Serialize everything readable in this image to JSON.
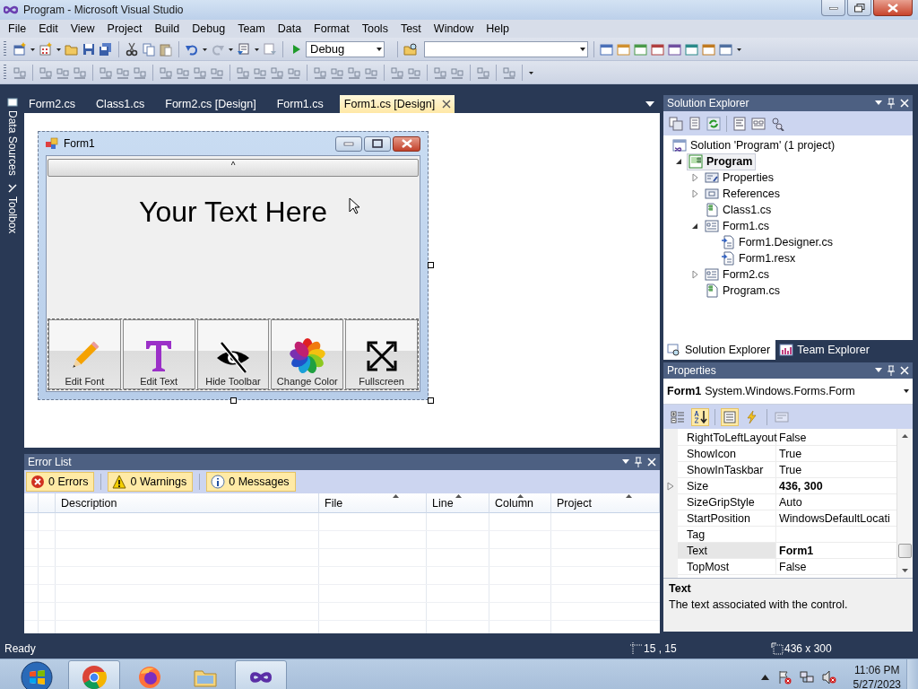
{
  "window": {
    "title": "Program - Microsoft Visual Studio"
  },
  "menu": [
    "File",
    "Edit",
    "View",
    "Project",
    "Build",
    "Debug",
    "Team",
    "Data",
    "Format",
    "Tools",
    "Test",
    "Window",
    "Help"
  ],
  "toolbar": {
    "configuration": "Debug"
  },
  "side_tabs": [
    "Data Sources",
    "Toolbox"
  ],
  "document_tabs": [
    {
      "label": "Form2.cs",
      "selected": false
    },
    {
      "label": "Class1.cs",
      "selected": false
    },
    {
      "label": "Form2.cs [Design]",
      "selected": false
    },
    {
      "label": "Form1.cs",
      "selected": false
    },
    {
      "label": "Form1.cs [Design]",
      "selected": true
    }
  ],
  "designer": {
    "form": {
      "title": "Form1",
      "collapse_glyph": "^",
      "label": "Your Text Here",
      "buttons": [
        {
          "kind": "pencil",
          "label": "Edit Font"
        },
        {
          "kind": "text",
          "label": "Edit Text"
        },
        {
          "kind": "hide",
          "label": "Hide Toolbar"
        },
        {
          "kind": "color",
          "label": "Change Color"
        },
        {
          "kind": "fullscreen",
          "label": "Fullscreen"
        }
      ]
    }
  },
  "error_list": {
    "title": "Error List",
    "filters": [
      {
        "kind": "error",
        "label": "0 Errors",
        "selected": true
      },
      {
        "kind": "warning",
        "label": "0 Warnings",
        "selected": true
      },
      {
        "kind": "message",
        "label": "0 Messages",
        "selected": true
      }
    ],
    "columns": [
      "Description",
      "File",
      "Line",
      "Column",
      "Project"
    ]
  },
  "solution_explorer": {
    "title": "Solution Explorer",
    "tree": [
      {
        "kind": "solution",
        "label": "Solution 'Program' (1 project)",
        "selected": false,
        "children": [
          {
            "kind": "project",
            "label": "Program",
            "expanded": true,
            "selected": true,
            "children": [
              {
                "kind": "properties",
                "label": "Properties",
                "expanded": false,
                "selected": false
              },
              {
                "kind": "references",
                "label": "References",
                "expanded": false,
                "selected": false
              },
              {
                "kind": "csfile",
                "label": "Class1.cs",
                "selected": false
              },
              {
                "kind": "form",
                "label": "Form1.cs",
                "expanded": true,
                "selected": false,
                "children": [
                  {
                    "kind": "designer",
                    "label": "Form1.Designer.cs",
                    "selected": false
                  },
                  {
                    "kind": "designer",
                    "label": "Form1.resx",
                    "selected": false
                  }
                ]
              },
              {
                "kind": "form",
                "label": "Form2.cs",
                "expanded": false,
                "selected": false
              },
              {
                "kind": "csfile",
                "label": "Program.cs",
                "selected": false
              }
            ]
          }
        ]
      }
    ],
    "tabs": [
      {
        "label": "Solution Explorer",
        "selected": true
      },
      {
        "label": "Team Explorer",
        "selected": false
      }
    ]
  },
  "properties": {
    "title": "Properties",
    "object_name": "Form1",
    "object_type": "System.Windows.Forms.Form",
    "tools": [
      {
        "kind": "categorized",
        "selected": false,
        "disabled": false
      },
      {
        "kind": "alphabetical",
        "selected": true,
        "disabled": false
      },
      {
        "kind": "properties",
        "selected": true,
        "disabled": false
      },
      {
        "kind": "events",
        "selected": false,
        "disabled": false
      },
      {
        "kind": "pages",
        "selected": false,
        "disabled": true
      }
    ],
    "rows": [
      {
        "name": "RightToLeftLayout",
        "value": "False",
        "bold": false,
        "expandable": false,
        "selected": false
      },
      {
        "name": "ShowIcon",
        "value": "True",
        "bold": false,
        "expandable": false,
        "selected": false
      },
      {
        "name": "ShowInTaskbar",
        "value": "True",
        "bold": false,
        "expandable": false,
        "selected": false
      },
      {
        "name": "Size",
        "value": "436, 300",
        "bold": true,
        "expandable": true,
        "selected": false
      },
      {
        "name": "SizeGripStyle",
        "value": "Auto",
        "bold": false,
        "expandable": false,
        "selected": false
      },
      {
        "name": "StartPosition",
        "value": "WindowsDefaultLocati",
        "bold": false,
        "expandable": false,
        "selected": false
      },
      {
        "name": "Tag",
        "expandable": false,
        "selected": false
      },
      {
        "name": "Text",
        "value": "Form1",
        "bold": true,
        "expandable": false,
        "selected": true
      },
      {
        "name": "TopMost",
        "value": "False",
        "bold": false,
        "expandable": false,
        "selected": false
      }
    ],
    "help_title": "Text",
    "help_text": "The text associated with the control."
  },
  "status_bar": {
    "text": "Ready",
    "position": "15 , 15",
    "size": "436 x 300"
  },
  "taskbar": {
    "apps": [
      {
        "kind": "chrome",
        "running": true
      },
      {
        "kind": "firefox",
        "running": false
      },
      {
        "kind": "explorer",
        "running": false
      },
      {
        "kind": "visualstudio",
        "running": true
      }
    ],
    "time": "11:06 PM",
    "date": "5/27/2023"
  }
}
